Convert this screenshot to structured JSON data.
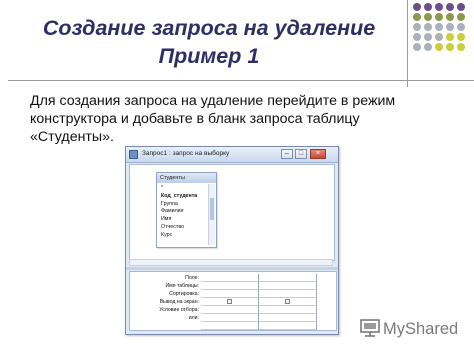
{
  "slide": {
    "title_lines": [
      "Создание запроса на удаление",
      "Пример 1"
    ],
    "body_lines": [
      "Для создания запроса на удаление перейдите в режим",
      "конструктора и добавьте в бланк запроса таблицу",
      "«Студенты»."
    ],
    "decoration_colors": [
      "#6b4f8a",
      "#8a9a4a",
      "#aab1b8",
      "#c9cf3a"
    ]
  },
  "window": {
    "title": "Запрос1 : запрос на выборку",
    "table": {
      "name": "Студенты",
      "fields": [
        "*",
        "Код_студента",
        "Группа",
        "Фамилия",
        "Имя",
        "Отчество",
        "Курс"
      ]
    },
    "grid_row_labels": [
      "Поле:",
      "Имя таблицы:",
      "Сортировка:",
      "Вывод на экран:",
      "Условие отбора:",
      "или:"
    ]
  },
  "watermark": {
    "text": "MyShared",
    "icon": "presentation-board-icon"
  }
}
